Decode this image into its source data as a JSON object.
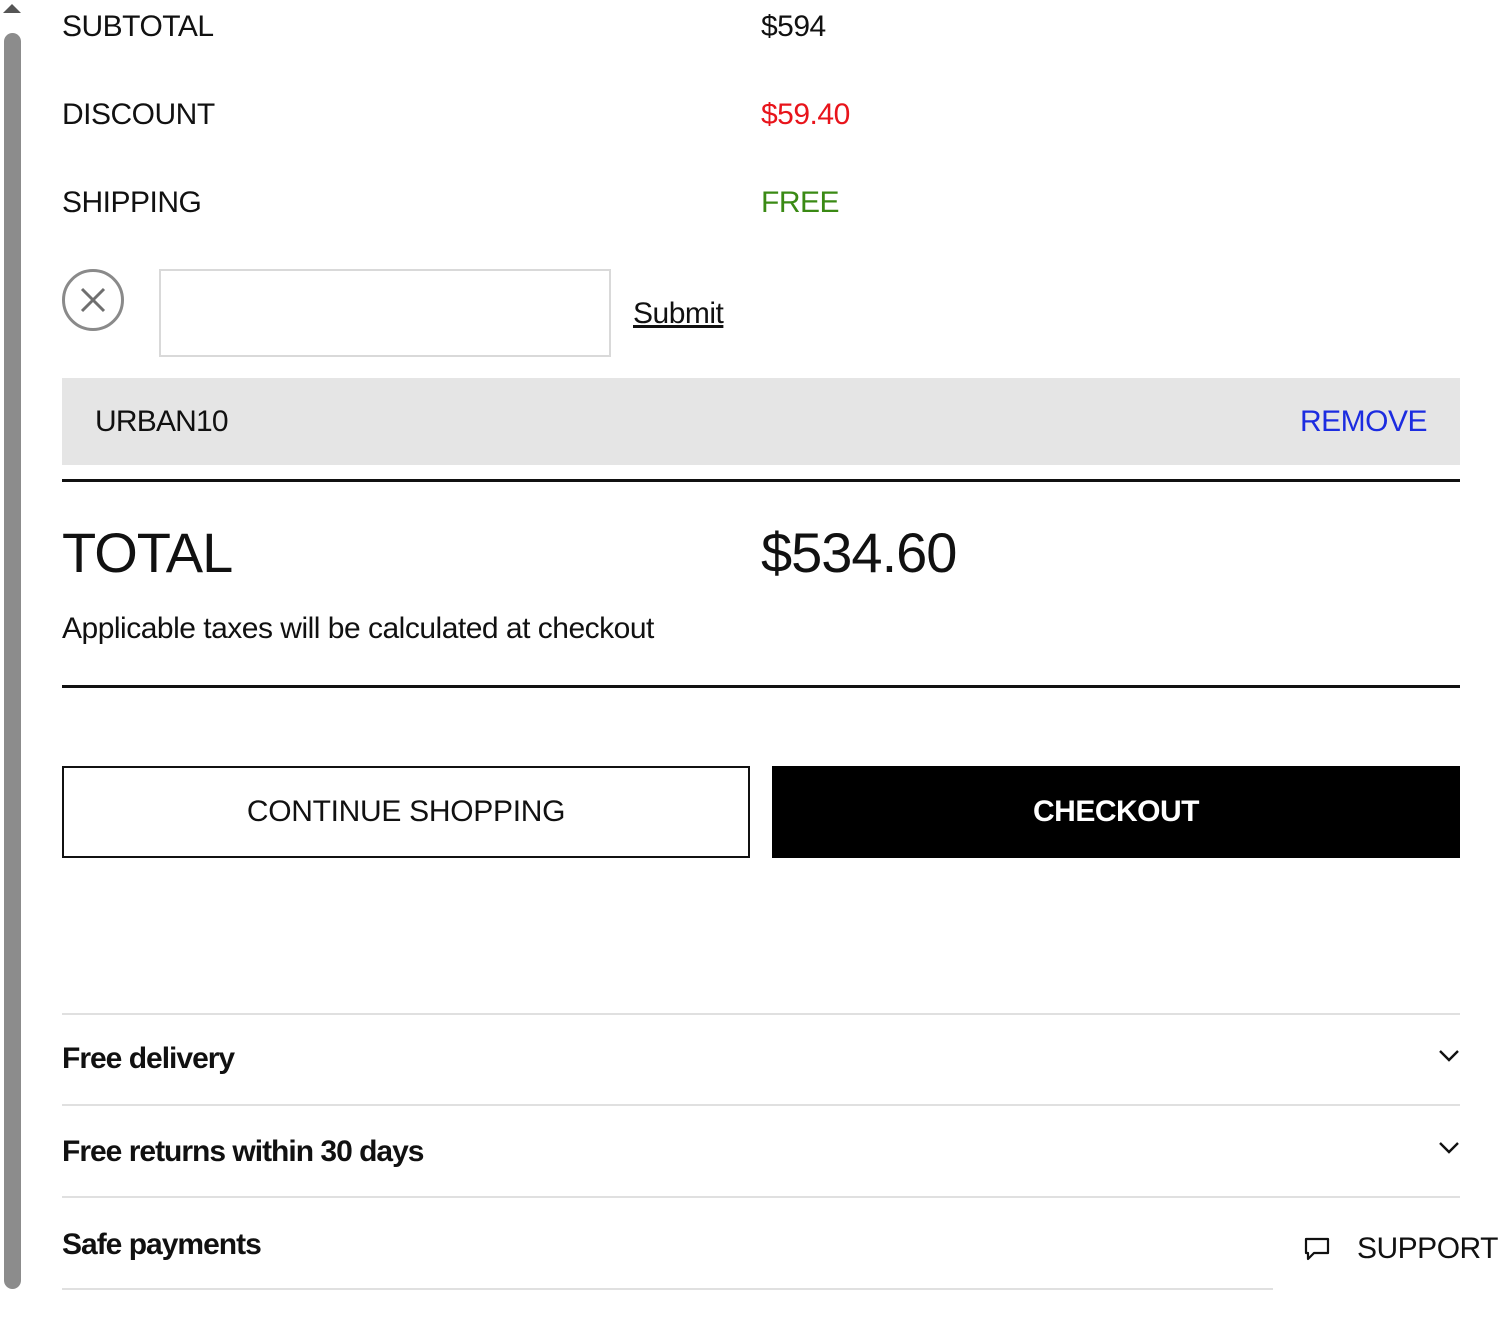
{
  "summary": {
    "subtotal_label": "SUBTOTAL",
    "subtotal_value": "$594",
    "discount_label": "DISCOUNT",
    "discount_value": "$59.40",
    "shipping_label": "SHIPPING",
    "shipping_value": "FREE"
  },
  "promo": {
    "input_value": "",
    "input_placeholder": "",
    "submit_label": "Submit",
    "applied_code": "URBAN10",
    "remove_label": "REMOVE"
  },
  "total": {
    "label": "TOTAL",
    "value": "$534.60",
    "tax_note": "Applicable taxes will be calculated at checkout"
  },
  "actions": {
    "continue_label": "CONTINUE SHOPPING",
    "checkout_label": "CHECKOUT"
  },
  "info_sections": [
    {
      "title": "Free delivery"
    },
    {
      "title": "Free returns within 30 days"
    },
    {
      "title": "Safe payments"
    }
  ],
  "support": {
    "label": "SUPPORT",
    "icon": "chat-bubble-icon"
  },
  "colors": {
    "discount": "#e8141b",
    "shipping_free": "#3a8a14",
    "remove_link": "#1c2ce0",
    "coupon_bg": "#e5e5e5",
    "checkout_bg": "#000000"
  }
}
